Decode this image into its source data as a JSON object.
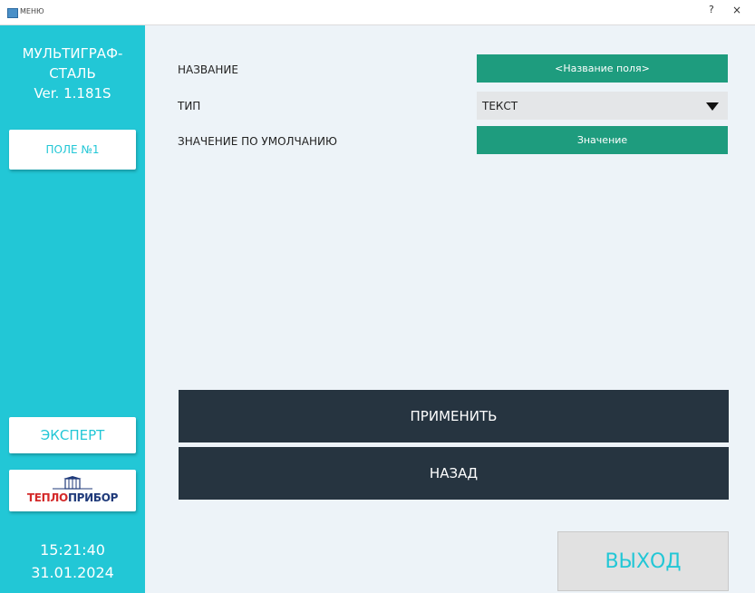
{
  "window": {
    "title": "МЕНЮ",
    "help_label": "?",
    "close_label": "×"
  },
  "sidebar": {
    "product_name_line1": "МУЛЬТИГРАФ-",
    "product_name_line2": "СТАЛЬ",
    "version": "Ver. 1.181S",
    "field_button": "ПОЛЕ №1",
    "expert_button": "ЭКСПЕРТ",
    "logo": {
      "part1": "ТЕПЛО",
      "part2": "ПРИБОР"
    },
    "time": "15:21:40",
    "date": "31.01.2024"
  },
  "form": {
    "name_label": "НАЗВАНИЕ",
    "name_value": "<Название поля>",
    "type_label": "ТИП",
    "type_value": "ТЕКСТ",
    "default_label": "ЗНАЧЕНИЕ ПО УМОЛЧАНИЮ",
    "default_value": "Значение"
  },
  "actions": {
    "apply": "ПРИМЕНИТЬ",
    "back": "НАЗАД",
    "exit": "ВЫХОД"
  },
  "colors": {
    "sidebar": "#22c7d6",
    "field_fill": "#1e9c7e",
    "dark_button": "#263440",
    "background": "#edf3f8"
  }
}
